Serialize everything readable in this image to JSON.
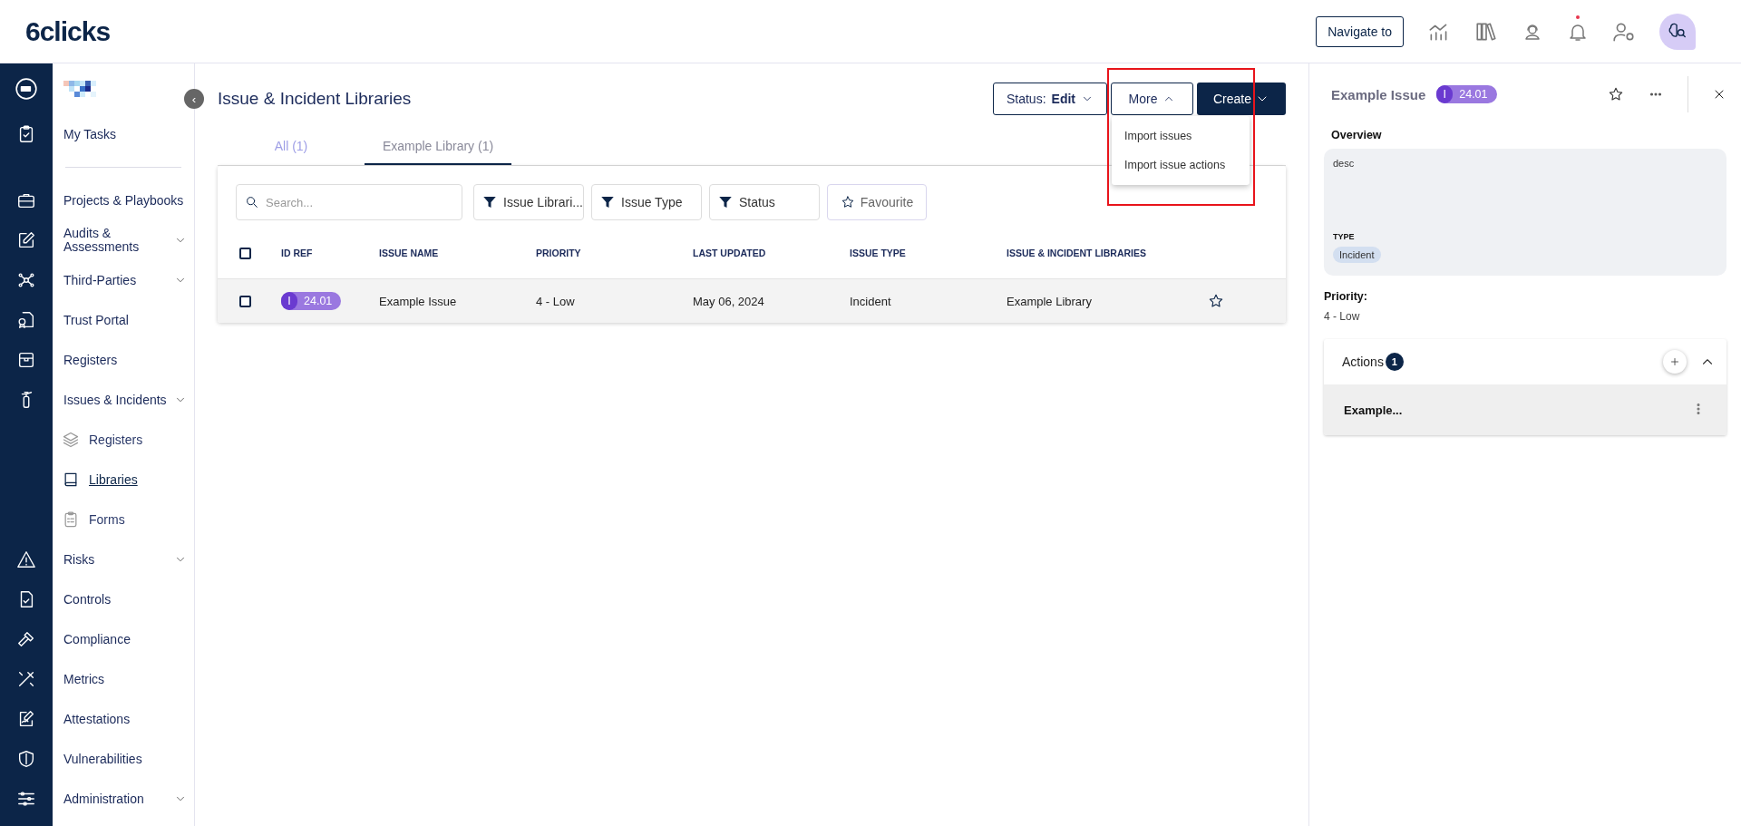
{
  "top_bar": {
    "logo": "6clicks",
    "navigate_button": "Navigate to",
    "notifications_unread": true
  },
  "sidebar": {
    "collapse_toggle": "‹",
    "items": [
      {
        "label": "My Tasks"
      },
      {
        "label": "Projects & Playbooks",
        "has_submenu": false
      },
      {
        "label": "Audits & Assessments",
        "has_submenu": true
      },
      {
        "label": "Third-Parties",
        "has_submenu": true
      },
      {
        "label": "Trust Portal",
        "has_submenu": false
      },
      {
        "label": "Registers",
        "has_submenu": false
      },
      {
        "label": "Issues & Incidents",
        "has_submenu": true,
        "children": [
          {
            "label": "Registers",
            "selected": false
          },
          {
            "label": "Libraries",
            "selected": true
          },
          {
            "label": "Forms",
            "selected": false
          }
        ]
      },
      {
        "label": "Risks",
        "has_submenu": true
      },
      {
        "label": "Controls",
        "has_submenu": false
      },
      {
        "label": "Compliance",
        "has_submenu": false
      },
      {
        "label": "Metrics",
        "has_submenu": false
      },
      {
        "label": "Attestations",
        "has_submenu": false
      },
      {
        "label": "Vulnerabilities",
        "has_submenu": false
      },
      {
        "label": "Administration",
        "has_submenu": true
      }
    ]
  },
  "page": {
    "title": "Issue & Incident Libraries",
    "status_button": "Status: **Edit**",
    "more_button": {
      "label": "More",
      "open": true,
      "items": [
        "Import issues",
        "Import issue actions"
      ]
    },
    "create_button": "Create",
    "tabs": [
      {
        "label": "All (1)",
        "selected": false
      },
      {
        "label": "Example Library (1)",
        "selected": true
      }
    ],
    "search": {
      "placeholder": "Search..."
    },
    "filters": [
      "Issue Librari...",
      "Issue Type",
      "Status"
    ],
    "favourite_filter": "Favourite",
    "table": {
      "columns": [
        "ID REF",
        "ISSUE NAME",
        "PRIORITY",
        "LAST UPDATED",
        "ISSUE TYPE",
        "ISSUE & INCIDENT LIBRARIES"
      ],
      "all_checked": false,
      "rows": [
        {
          "checked": false,
          "type_letter": "I",
          "id_ref": "24.01",
          "issue_name": "Example Issue",
          "priority": "4 - Low",
          "last_updated": "May 06, 2024",
          "issue_type": "Incident",
          "library": "Example Library",
          "favourite": false
        }
      ]
    }
  },
  "detail_panel": {
    "title": "Example Issue",
    "type_letter": "I",
    "id_ref": "24.01",
    "favourite": false,
    "overview_label": "Overview",
    "description": "desc",
    "type_label": "TYPE",
    "type_value": "Incident",
    "priority_label": "Priority:",
    "priority_value": "4 - Low",
    "actions": {
      "label": "Actions",
      "count": "1",
      "expanded": true,
      "items": [
        "Example..."
      ]
    }
  }
}
